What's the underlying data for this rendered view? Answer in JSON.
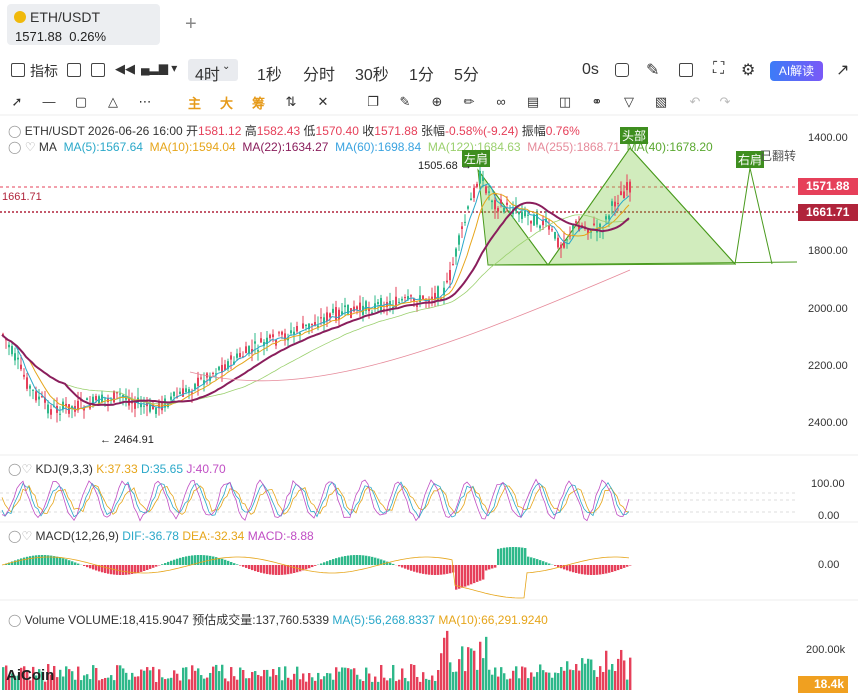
{
  "tab": {
    "symbol": "ETH/USDT",
    "price": "1571.88",
    "change": "0.26%",
    "add": "+"
  },
  "toolbar": {
    "indicator": "指标",
    "timeframes": [
      "4时",
      "1秒",
      "分时",
      "30秒",
      "1分",
      "5分"
    ],
    "zero_s": "0s",
    "ai": "AI解读"
  },
  "drawbar": {
    "main": "主",
    "big": "大",
    "chip": "筹"
  },
  "header": {
    "symbol": "ETH/USDT",
    "date": "2026-06-26 16:00",
    "open_l": "开",
    "open": "1581.12",
    "high_l": "高",
    "high": "1582.43",
    "low_l": "低",
    "low": "1570.40",
    "close_l": "收",
    "close": "1571.88",
    "chg_l": "张幅",
    "chg": "-0.58%(-9.24)",
    "amp_l": "振幅",
    "amp": "0.76%"
  },
  "ma": {
    "label": "MA",
    "ma5": "MA(5):1567.64",
    "ma10": "MA(10):1594.04",
    "ma22": "MA(22):1634.27",
    "ma60": "MA(60):1698.84",
    "ma122": "MA(122):1684.63",
    "ma255": "MA(255):1868.71",
    "ma40": "MA(40):1678.20"
  },
  "annotations": {
    "left_shoulder": "左肩",
    "head": "头部",
    "right_shoulder": "右肩",
    "flipped": "已翻转",
    "high_mark": "1505.68 →",
    "low_mark": "← 2464.91",
    "line_value": "1661.71"
  },
  "yaxis": {
    "main": [
      "1400.00",
      "1800.00",
      "2000.00",
      "2200.00",
      "2400.00"
    ],
    "kdj": [
      "100.00",
      "0.00"
    ],
    "macd": [
      "0.00"
    ],
    "vol": [
      "200.00k"
    ]
  },
  "tags": {
    "price": "1571.88",
    "line": "1661.71",
    "vol": "18.4k"
  },
  "kdj": {
    "label": "KDJ(9,3,3)",
    "k": "K:37.33",
    "d": "D:35.65",
    "j": "J:40.70"
  },
  "macd": {
    "label": "MACD(12,26,9)",
    "dif": "DIF:-36.78",
    "dea": "DEA:-32.34",
    "macd": "MACD:-8.88"
  },
  "volume": {
    "label": "Volume",
    "vol": "VOLUME:18,415.9047",
    "est": "预估成交量:137,760.5339",
    "ma5": "MA(5):56,268.8337",
    "ma10": "MA(10):66,291.9240"
  },
  "brand": "AiCoin",
  "colors": {
    "up": "#2eb88a",
    "down": "#e6405a",
    "ma5": "#2aa8c9",
    "ma10": "#e6a51a",
    "ma22": "#8a1e5c",
    "pattern": "#7ac943"
  }
}
